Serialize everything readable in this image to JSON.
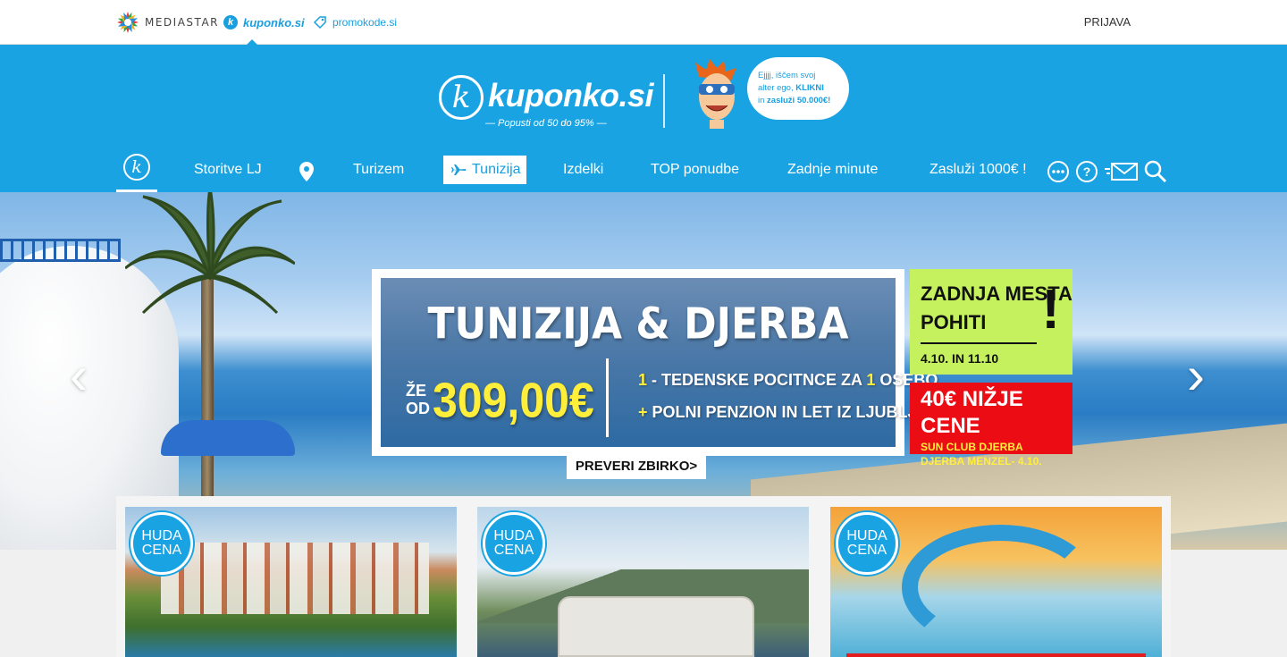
{
  "topbar": {
    "brands": [
      {
        "label": "MEDIASTAR"
      },
      {
        "label": "kuponko.si"
      },
      {
        "label": "promokode.si"
      }
    ],
    "login": "PRIJAVA"
  },
  "header": {
    "logo_letter": "k",
    "logo_text": "kuponko.si",
    "tagline": "— Popusti od 50 do 95% —",
    "bubble": {
      "line1": "Ejjjj, iščem svoj",
      "line2a": "alter ego, ",
      "line2b": "KLIKNI",
      "line3a": "in ",
      "line3b": "zasluži 50.000€!"
    }
  },
  "nav": {
    "items": [
      {
        "label": "Storitve LJ"
      },
      {
        "label": "Turizem"
      },
      {
        "label": "Tunizija"
      },
      {
        "label": "Izdelki"
      },
      {
        "label": "TOP ponudbe"
      },
      {
        "label": "Zadnje minute"
      },
      {
        "label": "Zasluži 1000€ !"
      }
    ],
    "icons": [
      "location-pin-icon",
      "more-icon",
      "help-icon",
      "mail-icon",
      "search-icon",
      "plane-icon"
    ]
  },
  "hero": {
    "title": "TUNIZIJA & DJERBA",
    "from_line1": "ŽE",
    "from_line2": "OD",
    "price": "309,00€",
    "line1_hl1": "1",
    "line1_text": " - TEDENSKE POCITNCE ZA ",
    "line1_hl2": "1",
    "line1_end": " OSEBO",
    "line2_hl": "+",
    "line2_text": " POLNI PENZION IN LET IZ LJUBLJANE",
    "cta": "PREVERI ZBIRKO>",
    "side_green": {
      "line1": "ZADNJA MESTA",
      "line2": "POHITI",
      "excl": "!",
      "dates": "4.10. IN 11.10"
    },
    "side_red": {
      "title": "40€ NIŽJE CENE",
      "line1": "SUN CLUB DJERBA",
      "line2": "DJERBA MENZEL- 4.10."
    },
    "arrow_prev": "‹",
    "arrow_next": "›"
  },
  "cards": [
    {
      "badge_line1": "HUDA",
      "badge_line2": "CENA"
    },
    {
      "badge_line1": "HUDA",
      "badge_line2": "CENA"
    },
    {
      "badge_line1": "HUDA",
      "badge_line2": "CENA"
    }
  ],
  "colors": {
    "brand_blue": "#1aa3e2",
    "promo_yellow": "#ffef3a",
    "side_green": "#c6f15e",
    "side_red": "#ec0d14"
  }
}
